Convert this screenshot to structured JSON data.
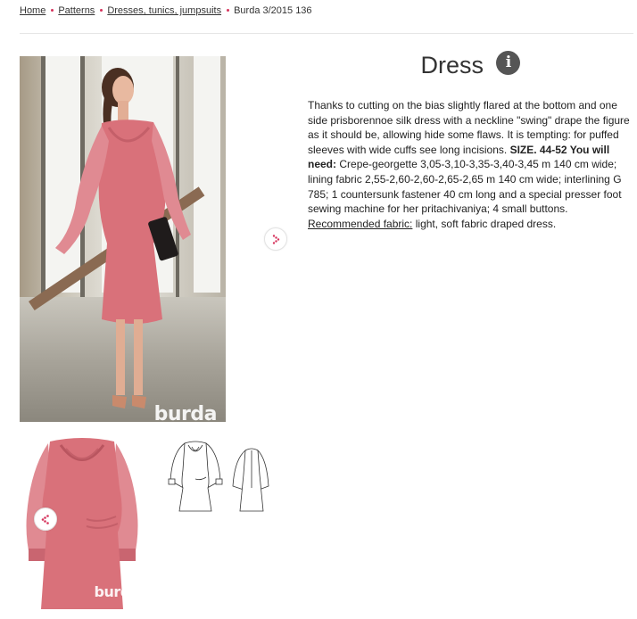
{
  "breadcrumb": {
    "home": "Home",
    "patterns": "Patterns",
    "category": "Dresses, tunics, jumpsuits",
    "current": "Burda 3/2015 136"
  },
  "product": {
    "title": "Dress",
    "info_icon_glyph": "i",
    "description_part1": "Thanks to cutting on the bias slightly flared at the bottom and one side prisborennoe silk dress with a neckline \"swing\" drape the figure as it should be, allowing hide some flaws. It is tempting: for puffed sleeves with wide cuffs see long incisions.",
    "size_label": "SIZE. 44-52 You will need:",
    "materials": "Crepe-georgette 3,05-3,10-3,35-3,40-3,45 m 140 cm wide; lining fabric 2,55-2,60-2,60-2,65-2,65 m 140 cm wide; interlining G 785; 1 countersunk fastener 40 cm long and a special presser foot sewing machine for her pritachivaniya; 4 small buttons.",
    "recommended_label": "Recommended fabric:",
    "recommended_text": "light, soft fabric draped dress."
  },
  "gallery": {
    "watermark": "burda",
    "next_icon": "chevron-right-icon",
    "share_icon": "share-icon"
  },
  "colors": {
    "accent": "#d6335c",
    "dress": "#d9717a",
    "icon_bg": "#555555"
  }
}
